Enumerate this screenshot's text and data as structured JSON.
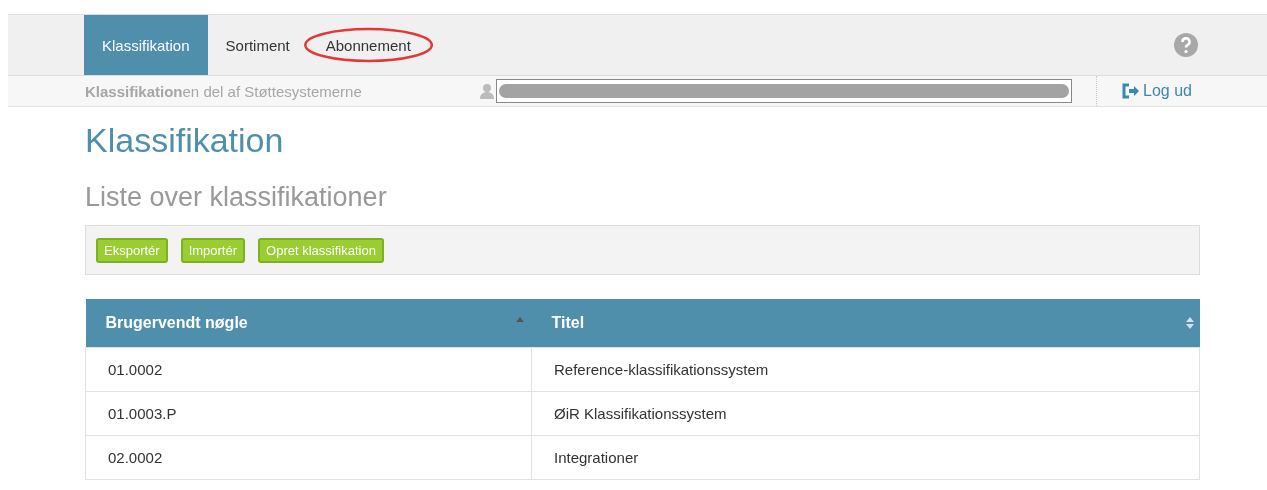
{
  "nav": {
    "tabs": [
      {
        "label": "Klassifikation",
        "selected": true,
        "highlighted": false
      },
      {
        "label": "Sortiment",
        "selected": false,
        "highlighted": false
      },
      {
        "label": "Abonnement",
        "selected": false,
        "highlighted": true
      }
    ]
  },
  "subbar": {
    "tagline": "**Klassifikation**en del af Støttesystemerne",
    "user_redacted": true,
    "logout": "Log ud"
  },
  "title": "Klassifikation",
  "subtitle": "Liste over klassifikationer",
  "toolbar": {
    "buttons": [
      "Eksportér",
      "Importér",
      "Opret klassifikation"
    ]
  },
  "table": {
    "columns": [
      {
        "label": "Brugervendt nøgle",
        "sorted": true
      },
      {
        "label": "Titel",
        "sorted": false
      }
    ],
    "rows": [
      [
        "01.0002",
        "Reference-klassifikationssystem"
      ],
      [
        "01.0003.P",
        "ØiR Klassifikationssystem"
      ],
      [
        "02.0002",
        "Integrationer"
      ]
    ]
  }
}
